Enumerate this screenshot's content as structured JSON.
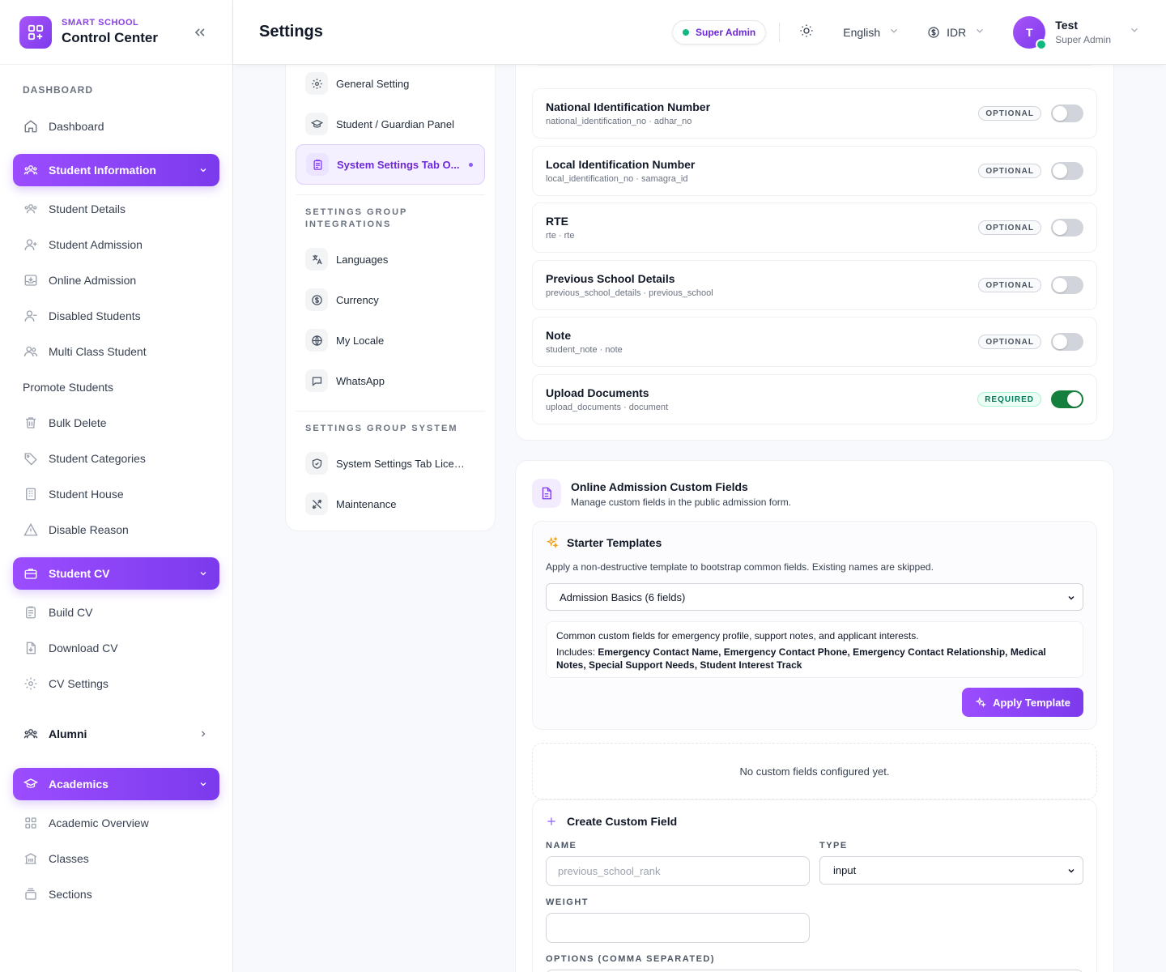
{
  "brand": {
    "small": "SMART SCHOOL",
    "big": "Control Center"
  },
  "sidebar": {
    "heading": "DASHBOARD",
    "dashboard": "Dashboard",
    "student_info": {
      "label": "Student Information",
      "items": [
        "Student Details",
        "Student Admission",
        "Online Admission",
        "Disabled Students",
        "Multi Class Student",
        "Promote Students",
        "Bulk Delete",
        "Student Categories",
        "Student House",
        "Disable Reason"
      ]
    },
    "student_cv": {
      "label": "Student CV",
      "items": [
        "Build CV",
        "Download CV",
        "CV Settings"
      ]
    },
    "alumni": "Alumni",
    "academics": {
      "label": "Academics",
      "items": [
        "Academic Overview",
        "Classes",
        "Sections"
      ]
    }
  },
  "header": {
    "title": "Settings",
    "role_badge": "Super Admin",
    "language": "English",
    "currency": "IDR",
    "user": {
      "initial": "T",
      "name": "Test",
      "role": "Super Admin"
    }
  },
  "settings_nav": {
    "items_top": [
      "General Setting",
      "Student / Guardian Panel",
      "System Settings Tab O..."
    ],
    "group_integrations": "SETTINGS GROUP INTEGRATIONS",
    "items_integrations": [
      "Languages",
      "Currency",
      "My Locale",
      "WhatsApp"
    ],
    "group_system": "SETTINGS GROUP SYSTEM",
    "items_system": [
      "System Settings Tab License",
      "Maintenance"
    ]
  },
  "fields": [
    {
      "title": "National Identification Number",
      "sub": "national_identification_no · adhar_no",
      "badge": "OPTIONAL",
      "on": false
    },
    {
      "title": "Local Identification Number",
      "sub": "local_identification_no · samagra_id",
      "badge": "OPTIONAL",
      "on": false
    },
    {
      "title": "RTE",
      "sub": "rte · rte",
      "badge": "OPTIONAL",
      "on": false
    },
    {
      "title": "Previous School Details",
      "sub": "previous_school_details · previous_school",
      "badge": "OPTIONAL",
      "on": false
    },
    {
      "title": "Note",
      "sub": "student_note · note",
      "badge": "OPTIONAL",
      "on": false
    },
    {
      "title": "Upload Documents",
      "sub": "upload_documents · document",
      "badge": "REQUIRED",
      "on": true
    }
  ],
  "custom": {
    "title": "Online Admission Custom Fields",
    "subtitle": "Manage custom fields in the public admission form.",
    "templates": {
      "title": "Starter Templates",
      "description": "Apply a non-destructive template to bootstrap common fields. Existing names are skipped.",
      "selected": "Admission Basics (6 fields)",
      "info": "Common custom fields for emergency profile, support notes, and applicant interests.",
      "includes_label": "Includes:",
      "includes": "Emergency Contact Name, Emergency Contact Phone, Emergency Contact Relationship, Medical Notes, Special Support Needs, Student Interest Track",
      "apply": "Apply Template"
    },
    "empty": "No custom fields configured yet.",
    "create": {
      "title": "Create Custom Field",
      "name_label": "NAME",
      "name_placeholder": "previous_school_rank",
      "type_label": "TYPE",
      "type_value": "input",
      "weight_label": "WEIGHT",
      "options_label": "OPTIONS (COMMA SEPARATED)"
    }
  }
}
